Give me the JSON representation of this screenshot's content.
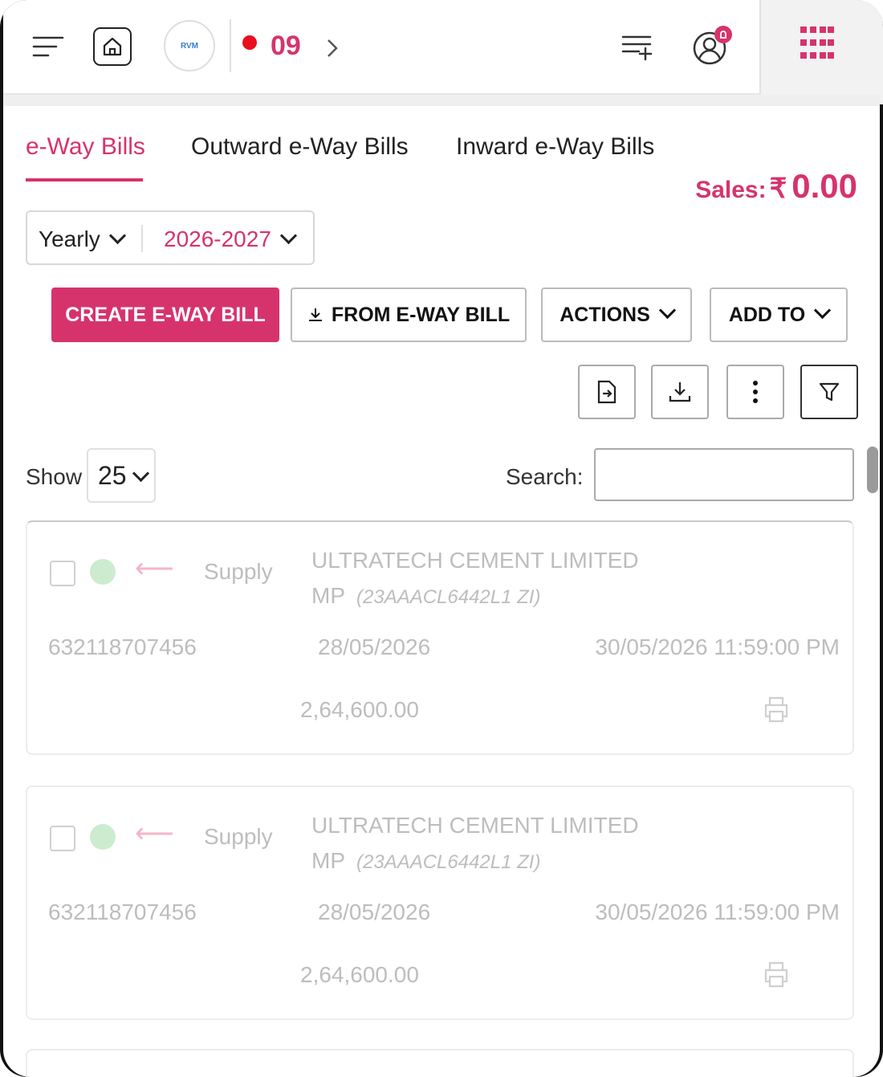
{
  "header": {
    "notification_count": "09",
    "logo_text": "RVM",
    "icons": [
      "menu-icon",
      "home-icon",
      "chevron-right-icon",
      "list-add-icon",
      "user-bell-icon",
      "apps-grid-icon"
    ]
  },
  "tabs": [
    {
      "label": "e-Way Bills",
      "active": true
    },
    {
      "label": "Outward e-Way Bills",
      "active": false
    },
    {
      "label": "Inward e-Way Bills",
      "active": false
    }
  ],
  "sales": {
    "label": "Sales:",
    "currency": "₹",
    "value": "0.00"
  },
  "period": {
    "type": "Yearly",
    "year": "2026-2027"
  },
  "buttons": {
    "create": "CREATE E-WAY BILL",
    "from": "FROM E-WAY BILL",
    "actions": "ACTIONS",
    "add_to": "ADD TO"
  },
  "toolbar_icons": [
    "import-file-icon",
    "download-icon",
    "more-vertical-icon",
    "filter-icon"
  ],
  "table_controls": {
    "show_label": "Show",
    "show_value": "25",
    "search_label": "Search:",
    "search_value": ""
  },
  "records": [
    {
      "type": "Supply",
      "party": "ULTRATECH CEMENT LIMITED MP",
      "gstin": "(23AAACL6442L1 ZI)",
      "ewb_number": "632118707456",
      "date": "28/05/2026",
      "valid_until": "30/05/2026 11:59:00 PM",
      "amount": "2,64,600.00"
    },
    {
      "type": "Supply",
      "party": "ULTRATECH CEMENT LIMITED MP",
      "gstin": "(23AAACL6442L1 ZI)",
      "ewb_number": "632118707456",
      "date": "28/05/2026",
      "valid_until": "30/05/2026 11:59:00 PM",
      "amount": "2,64,600.00"
    }
  ],
  "colors": {
    "accent": "#d6336c",
    "status_dot": "#e8101c"
  }
}
